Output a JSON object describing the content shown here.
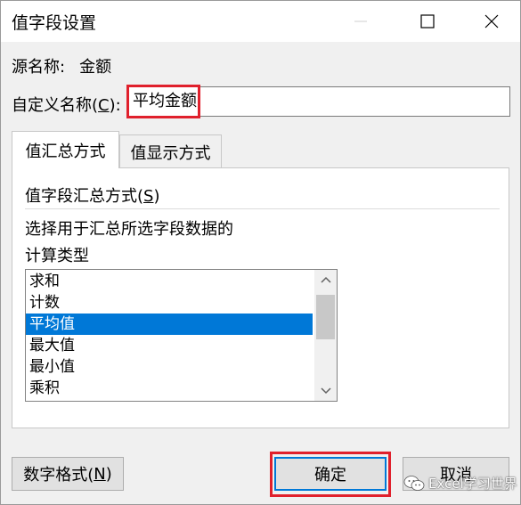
{
  "window": {
    "title": "值字段设置"
  },
  "source": {
    "label": "源名称:",
    "value": "金额"
  },
  "custom_name": {
    "label_prefix": "自定义名称(",
    "label_key": "C",
    "label_suffix": "):",
    "value": "平均金额"
  },
  "tabs": [
    {
      "label": "值汇总方式",
      "active": true
    },
    {
      "label": "值显示方式",
      "active": false
    }
  ],
  "summary": {
    "heading_prefix": "值字段汇总方式(",
    "heading_key": "S",
    "heading_suffix": ")",
    "description_line1": "选择用于汇总所选字段数据的",
    "description_line2": "计算类型",
    "items": [
      "求和",
      "计数",
      "平均值",
      "最大值",
      "最小值",
      "乘积"
    ],
    "selected_item": "平均值"
  },
  "buttons": {
    "number_format_prefix": "数字格式(",
    "number_format_key": "N",
    "number_format_suffix": ")",
    "ok": "确定",
    "cancel": "取消"
  },
  "watermark": {
    "text": "Excel学习世界",
    "icon": "wechat-icon"
  },
  "colors": {
    "selection": "#0078d7",
    "highlight_box": "#e0202c"
  }
}
